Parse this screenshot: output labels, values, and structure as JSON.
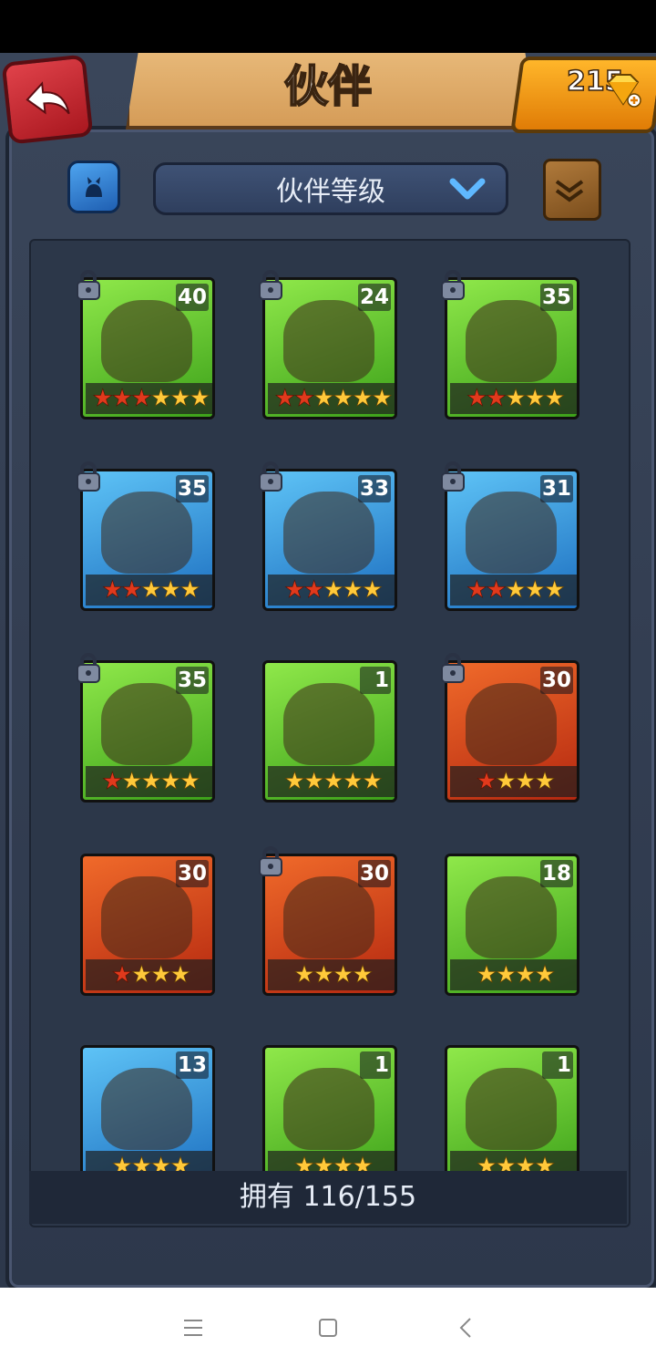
{
  "header": {
    "title": "伙伴",
    "gem_count": "215"
  },
  "toolbar": {
    "sort_label": "伙伴等级"
  },
  "cards": [
    {
      "level": "40",
      "red": 3,
      "gold": 3,
      "theme": "green",
      "locked": true
    },
    {
      "level": "24",
      "red": 2,
      "gold": 4,
      "theme": "green",
      "locked": true
    },
    {
      "level": "35",
      "red": 2,
      "gold": 3,
      "theme": "green",
      "locked": true
    },
    {
      "level": "35",
      "red": 2,
      "gold": 3,
      "theme": "blue",
      "locked": true
    },
    {
      "level": "33",
      "red": 2,
      "gold": 3,
      "theme": "blue",
      "locked": true
    },
    {
      "level": "31",
      "red": 2,
      "gold": 3,
      "theme": "blue",
      "locked": true
    },
    {
      "level": "35",
      "red": 1,
      "gold": 4,
      "theme": "green",
      "locked": true
    },
    {
      "level": "1",
      "red": 0,
      "gold": 5,
      "theme": "green",
      "locked": false
    },
    {
      "level": "30",
      "red": 1,
      "gold": 3,
      "theme": "red",
      "locked": true
    },
    {
      "level": "30",
      "red": 1,
      "gold": 3,
      "theme": "red",
      "locked": false
    },
    {
      "level": "30",
      "red": 0,
      "gold": 4,
      "theme": "red",
      "locked": true
    },
    {
      "level": "18",
      "red": 0,
      "gold": 4,
      "theme": "green",
      "locked": false
    },
    {
      "level": "13",
      "red": 0,
      "gold": 4,
      "theme": "blue",
      "locked": false
    },
    {
      "level": "1",
      "red": 0,
      "gold": 4,
      "theme": "green",
      "locked": false
    },
    {
      "level": "1",
      "red": 0,
      "gold": 4,
      "theme": "green",
      "locked": false
    }
  ],
  "footer": {
    "owned_text": "拥有 116/155"
  },
  "icons": {
    "back": "back-arrow-icon",
    "gem": "diamond-plus-icon",
    "filter": "cat-filter-icon",
    "book": "scroll-book-icon",
    "lock": "padlock-icon"
  }
}
